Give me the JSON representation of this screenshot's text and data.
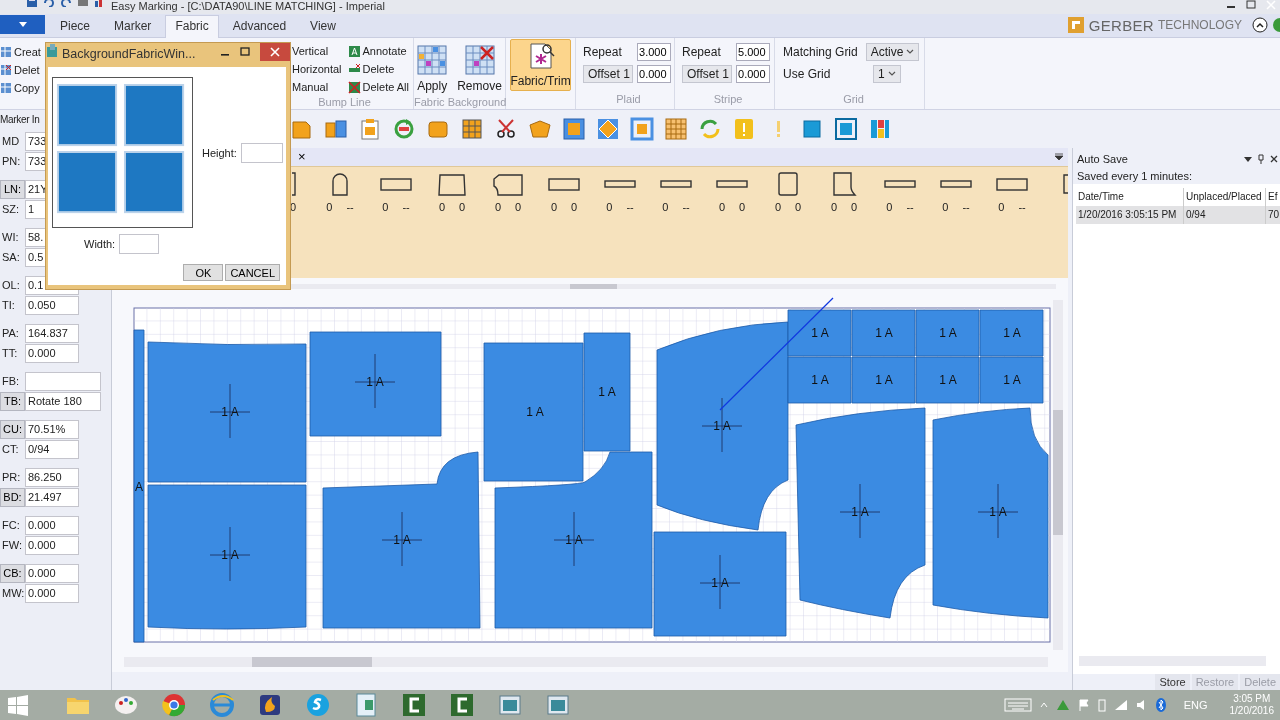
{
  "title_bar": {
    "title": "Easy Marking - [C:\\DATA90\\LINE MATCHING] - Imperial"
  },
  "ribbon": {
    "tabs": [
      {
        "label": "Piece",
        "selected": false
      },
      {
        "label": "Marker",
        "selected": false
      },
      {
        "label": "Fabric",
        "selected": true
      },
      {
        "label": "Advanced",
        "selected": false
      },
      {
        "label": "View",
        "selected": false
      }
    ],
    "brand": {
      "name": "GERBER",
      "suffix": "TECHNOLOGY"
    },
    "left_column": [
      "Creat",
      "Delet",
      "Copy"
    ],
    "bump_line": {
      "label": "Bump Line",
      "column_1": [
        "Vertical",
        "Horizontal",
        "Manual"
      ],
      "column_2": [
        "Annotate",
        "Delete",
        "Delete All"
      ]
    },
    "fabric_background": {
      "label": "Fabric Background",
      "buttons": [
        "Apply",
        "Remove"
      ]
    },
    "fabric_trim": {
      "label": "Fabric/Trim",
      "selected": true
    },
    "plaid": {
      "label": "Plaid",
      "repeat_label": "Repeat",
      "repeat": "3.000",
      "offset": "Offset 1",
      "offset_value": "0.000"
    },
    "stripe": {
      "label": "Stripe",
      "repeat_label": "Repeat",
      "repeat": "5.000",
      "offset": "Offset 1",
      "offset_value": "0.000"
    },
    "grid": {
      "label": "Grid",
      "matching_grid_label": "Matching Grid",
      "matching_grid": "Active",
      "use_grid_label": "Use Grid",
      "use_grid": "1"
    }
  },
  "toolbar": {
    "tools": [
      {
        "kind": "piece"
      },
      {
        "kind": "pieces"
      },
      {
        "kind": "clipboard"
      },
      {
        "kind": "rotate"
      },
      {
        "kind": "shape"
      },
      {
        "kind": "grid"
      },
      {
        "kind": "scissors"
      },
      {
        "kind": "fold"
      },
      {
        "kind": "block"
      },
      {
        "kind": "diamond"
      },
      {
        "kind": "frame"
      },
      {
        "kind": "gridbox"
      },
      {
        "kind": "arrows"
      },
      {
        "kind": "warning"
      },
      {
        "kind": "exclamation"
      },
      {
        "kind": "square"
      },
      {
        "kind": "square2"
      },
      {
        "kind": "bars"
      }
    ]
  },
  "marker_info": {
    "title": "Marker In",
    "groups": [
      [
        {
          "label": "MD",
          "value": "733",
          "kind": "text"
        },
        {
          "label": "PN:",
          "value": "733",
          "kind": "text"
        }
      ],
      [
        {
          "label": "LN:",
          "value": "21Y",
          "kind": "button"
        },
        {
          "label": "SZ:",
          "value": "1",
          "kind": "text"
        }
      ],
      [
        {
          "label": "WI:",
          "value": "58.",
          "kind": "text"
        },
        {
          "label": "SA:",
          "value": "0.5",
          "kind": "text"
        }
      ],
      [
        {
          "label": "OL:",
          "value": "0.1",
          "kind": "text"
        },
        {
          "label": "TI:",
          "value": "0.050",
          "kind": "text"
        }
      ],
      [
        {
          "label": "PA:",
          "value": "164.837",
          "kind": "text"
        },
        {
          "label": "TT:",
          "value": "0.000",
          "kind": "text"
        }
      ],
      [
        {
          "label": "FB:",
          "kind": "text"
        },
        {
          "label": "TB:",
          "value": "Rotate 180",
          "kind": "button"
        }
      ],
      [
        {
          "label": "CU:",
          "value": "70.51%",
          "kind": "button"
        },
        {
          "label": "CT:",
          "value": "0/94",
          "kind": "text"
        }
      ],
      [
        {
          "label": "PR:",
          "value": "86.250",
          "kind": "text"
        },
        {
          "label": "BD:",
          "value": "21.497",
          "kind": "button"
        }
      ],
      [
        {
          "label": "FC:",
          "value": "0.000",
          "kind": "text"
        },
        {
          "label": "FW:",
          "value": "0.000",
          "kind": "text"
        }
      ],
      [
        {
          "label": "CB:",
          "value": "0.000",
          "kind": "button"
        },
        {
          "label": "MW:",
          "value": "0.000",
          "kind": "text"
        }
      ]
    ]
  },
  "piece_strip": {
    "close": "×",
    "thumbnails": [
      {
        "kind": "partial",
        "counts": [
          "0"
        ]
      },
      {
        "kind": "arch",
        "counts": [
          "0",
          "--"
        ]
      },
      {
        "kind": "rect",
        "counts": [
          "0",
          "--"
        ]
      },
      {
        "kind": "trapezoid",
        "counts": [
          "0",
          "0"
        ]
      },
      {
        "kind": "notched",
        "counts": [
          "0",
          "0"
        ]
      },
      {
        "kind": "rect",
        "counts": [
          "0",
          "0"
        ]
      },
      {
        "kind": "slim",
        "counts": [
          "0",
          "--"
        ]
      },
      {
        "kind": "slim",
        "counts": [
          "0",
          "--"
        ]
      },
      {
        "kind": "slim",
        "counts": [
          "0",
          "0"
        ]
      },
      {
        "kind": "tall",
        "counts": [
          "0",
          "0"
        ]
      },
      {
        "kind": "tallnotch",
        "counts": [
          "0",
          "0"
        ]
      },
      {
        "kind": "slim",
        "counts": [
          "0",
          "--"
        ]
      },
      {
        "kind": "slim",
        "counts": [
          "0",
          "--"
        ]
      },
      {
        "kind": "rect",
        "counts": [
          "0",
          "--"
        ]
      },
      {
        "kind": "partial_right"
      }
    ]
  },
  "marker": {
    "pieces": [
      {
        "label": "A"
      },
      {
        "label": "1 A"
      },
      {
        "label": "1 A"
      },
      {
        "label": "1 A"
      },
      {
        "label": "1 A"
      },
      {
        "label": "1 A"
      },
      {
        "label": "1 A"
      },
      {
        "label": "1 A"
      },
      {
        "label": "1 A"
      },
      {
        "label": "1 A"
      },
      {
        "label": "1 A"
      },
      {
        "label": "1 A"
      },
      {
        "label": "1 A"
      },
      {
        "label": "1 A"
      },
      {
        "label": "1 A"
      },
      {
        "label": "1 A"
      },
      {
        "label": "1 A"
      },
      {
        "label": "1 A"
      },
      {
        "label": "1 A"
      },
      {
        "label": "1 A"
      }
    ]
  },
  "auto_save": {
    "title": "Auto Save",
    "note": "Saved every 1 minutes:",
    "columns": [
      "Date/Time",
      "Unplaced/Placed",
      "Ef"
    ],
    "rows": [
      {
        "cells": [
          "1/20/2016 3:05:15 PM",
          "0/94",
          "70"
        ],
        "selected": true
      }
    ],
    "buttons": [
      {
        "label": "Store",
        "disabled": false
      },
      {
        "label": "Restore",
        "disabled": true
      },
      {
        "label": "Delete",
        "disabled": true
      }
    ]
  },
  "dialog": {
    "title": "BackgroundFabricWin...",
    "height_label": "Height:",
    "width_label": "Width:",
    "buttons": [
      "OK",
      "CANCEL"
    ]
  },
  "taskbar": {
    "apps": [
      {
        "kind": "folder"
      },
      {
        "kind": "paint"
      },
      {
        "kind": "browser"
      },
      {
        "kind": "globe"
      },
      {
        "kind": "flame"
      },
      {
        "kind": "chat"
      },
      {
        "kind": "document"
      },
      {
        "kind": "recorder"
      },
      {
        "kind": "recorder"
      },
      {
        "kind": "window"
      },
      {
        "kind": "window"
      }
    ],
    "language": "ENG",
    "time": "3:05 PM",
    "date": "1/20/2016"
  }
}
